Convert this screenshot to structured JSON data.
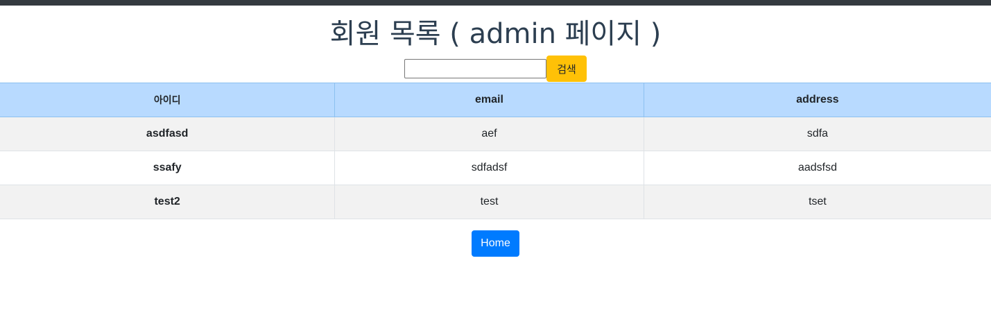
{
  "page": {
    "title": "회원 목록 ( admin 페이지 )"
  },
  "search": {
    "value": "",
    "placeholder": "",
    "button_label": "검색"
  },
  "table": {
    "headers": [
      "아이디",
      "email",
      "address"
    ],
    "rows": [
      [
        "asdfasd",
        "aef",
        "sdfa"
      ],
      [
        "ssafy",
        "sdfadsf",
        "aadsfsd"
      ],
      [
        "test2",
        "test",
        "tset"
      ]
    ]
  },
  "footer": {
    "home_label": "Home"
  },
  "colors": {
    "topbar": "#343a40",
    "header_bg": "#b8daff",
    "search_button": "#ffc107",
    "home_button": "#007bff"
  }
}
